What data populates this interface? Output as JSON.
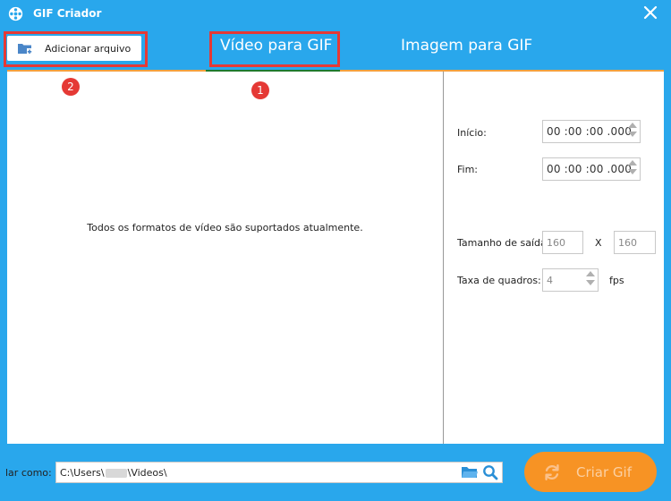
{
  "window": {
    "title": "GIF Criador",
    "accent": "#29a7ec"
  },
  "toolbar": {
    "add_file_label": "Adicionar arquivo"
  },
  "tabs": [
    {
      "label": "Vídeo para GIF",
      "active": true
    },
    {
      "label": "Imagem para GIF",
      "active": false
    }
  ],
  "markers": [
    "1",
    "2"
  ],
  "main": {
    "drop_message": "Todos os formatos de vídeo são suportados atualmente."
  },
  "settings": {
    "start_label": "Início:",
    "start_value": "00 :00 :00 .000",
    "end_label": "Fim:",
    "end_value": "00 :00 :00 .000",
    "output_size_label": "Tamanho de saída:",
    "width_value": "160",
    "times_sign": "X",
    "height_value": "160",
    "frame_rate_label": "Taxa de quadros:",
    "frame_rate_value": "4",
    "fps_unit": "fps"
  },
  "footer": {
    "save_as_label": "lar como:",
    "path_prefix": "C:\\Users\\",
    "path_suffix": "\\Videos\\",
    "create_label": "Criar Gif",
    "create_color": "#f79324"
  }
}
